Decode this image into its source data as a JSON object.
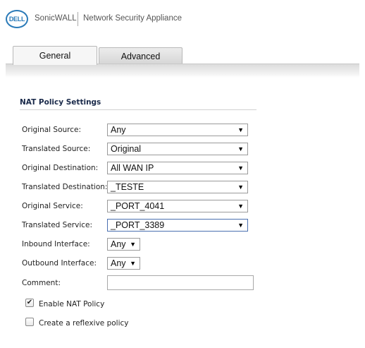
{
  "header": {
    "logo_text": "DELL",
    "brand": "SonicWALL",
    "product": "Network Security Appliance"
  },
  "tabs": [
    {
      "label": "General",
      "active": true
    },
    {
      "label": "Advanced",
      "active": false
    }
  ],
  "section": {
    "title": "NAT Policy Settings"
  },
  "fields": {
    "original_source": {
      "label": "Original Source:",
      "value": "Any"
    },
    "translated_source": {
      "label": "Translated Source:",
      "value": "Original"
    },
    "original_destination": {
      "label": "Original Destination:",
      "value": "All WAN IP"
    },
    "translated_destination": {
      "label": "Translated Destination:",
      "value": "_TESTE"
    },
    "original_service": {
      "label": "Original Service:",
      "value": "_PORT_4041"
    },
    "translated_service": {
      "label": "Translated Service:",
      "value": "_PORT_3389"
    },
    "inbound_interface": {
      "label": "Inbound Interface:",
      "value": "Any"
    },
    "outbound_interface": {
      "label": "Outbound Interface:",
      "value": "Any"
    },
    "comment": {
      "label": "Comment:",
      "value": ""
    }
  },
  "checkboxes": {
    "enable_nat": {
      "label": "Enable NAT Policy",
      "checked": true
    },
    "reflexive": {
      "label": "Create a reflexive policy",
      "checked": false
    }
  },
  "glyphs": {
    "dropdown_arrow": "▼",
    "check_mark": "✔"
  },
  "colors": {
    "logo": "#2a7ab8",
    "section_title": "#1a2a4a"
  }
}
